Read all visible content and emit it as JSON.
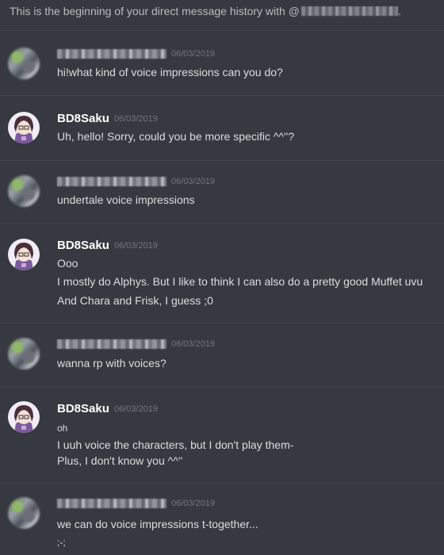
{
  "intro": {
    "text": "This is the beginning of your direct message history with @",
    "suffix": "."
  },
  "messages": [
    {
      "author": "",
      "author_redacted": true,
      "timestamp": "06/03/2019",
      "lines": [
        "hi!what kind of voice impressions can you do?"
      ]
    },
    {
      "author": "BD8Saku",
      "author_redacted": false,
      "timestamp": "06/03/2019",
      "lines": [
        "Uh, hello! Sorry, could you be more specific ^^''?"
      ]
    },
    {
      "author": "",
      "author_redacted": true,
      "timestamp": "06/03/2019",
      "lines": [
        "undertale voice impressions"
      ]
    },
    {
      "author": "BD8Saku",
      "author_redacted": false,
      "timestamp": "06/03/2019",
      "lines": [
        "Ooo",
        "I mostly do Alphys. But I like to think I can also do a pretty good Muffet uvu",
        "And Chara and Frisk, I guess ;0"
      ]
    },
    {
      "author": "",
      "author_redacted": true,
      "timestamp": "06/03/2019",
      "lines": [
        "wanna rp with voices?"
      ]
    },
    {
      "author": "BD8Saku",
      "author_redacted": false,
      "timestamp": "06/03/2019",
      "lines": [
        "oh",
        "I uuh voice the characters, but I don't play them-",
        "Plus, I don't know you ^^''"
      ]
    },
    {
      "author": "",
      "author_redacted": true,
      "timestamp": "06/03/2019",
      "lines": [
        "we can do voice impressions t-together...",
        ";-;"
      ]
    }
  ]
}
